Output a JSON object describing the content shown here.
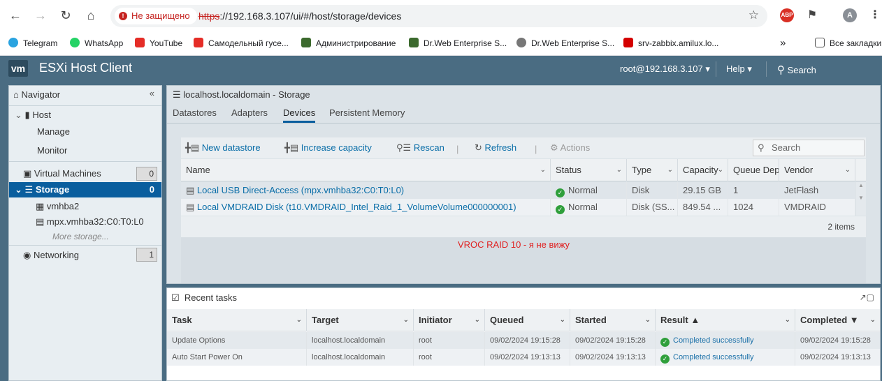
{
  "browser": {
    "insecure_label": "Не защищено",
    "url_scheme": "https",
    "url_rest": "://192.168.3.107/ui/#/host/storage/devices",
    "avatar_letter": "A",
    "abp_label": "ABP",
    "bookmarks": [
      "Telegram",
      "WhatsApp",
      "YouTube",
      "Самодельный гусе...",
      "Администрирование",
      "Dr.Web Enterprise S...",
      "Dr.Web Enterprise S...",
      "srv-zabbix.amilux.lo..."
    ],
    "more_bookmarks": "»",
    "all_bookmarks": "Все закладки"
  },
  "header": {
    "logo": "vm",
    "title": "ESXi Host Client",
    "user": "root@192.168.3.107",
    "help": "Help",
    "search": "Search"
  },
  "navigator": {
    "title": "Navigator",
    "host": "Host",
    "manage": "Manage",
    "monitor": "Monitor",
    "vms": "Virtual Machines",
    "vms_count": "0",
    "storage": "Storage",
    "storage_count": "0",
    "vmhba2": "vmhba2",
    "mpx": "mpx.vmhba32:C0:T0:L0",
    "more_storage": "More storage...",
    "networking": "Networking",
    "networking_count": "1"
  },
  "main": {
    "title": "localhost.localdomain - Storage",
    "tabs": [
      "Datastores",
      "Adapters",
      "Devices",
      "Persistent Memory"
    ],
    "toolbar": {
      "new_datastore": "New datastore",
      "increase_capacity": "Increase capacity",
      "rescan": "Rescan",
      "refresh": "Refresh",
      "actions": "Actions",
      "search_placeholder": "Search"
    },
    "columns": [
      "Name",
      "Status",
      "Type",
      "Capacity",
      "Queue Dep",
      "Vendor"
    ],
    "rows": [
      {
        "name": "Local USB Direct-Access (mpx.vmhba32:C0:T0:L0)",
        "status": "Normal",
        "type": "Disk",
        "capacity": "29.15 GB",
        "queue": "1",
        "vendor": "JetFlash"
      },
      {
        "name": "Local VMDRAID Disk (t10.VMDRAID_Intel_Raid_1_VolumeVolume000000001)",
        "status": "Normal",
        "type": "Disk (SS...",
        "capacity": "849.54 ...",
        "queue": "1024",
        "vendor": "VMDRAID"
      }
    ],
    "items_count": "2 items",
    "annotation": "VROC RAID 10 - я не вижу",
    "annotation_color": "#e02020"
  },
  "recent": {
    "title": "Recent tasks",
    "columns": [
      "Task",
      "Target",
      "Initiator",
      "Queued",
      "Started",
      "Result ▲",
      "Completed ▼"
    ],
    "rows": [
      {
        "task": "Update Options",
        "target": "localhost.localdomain",
        "initiator": "root",
        "queued": "09/02/2024 19:15:28",
        "started": "09/02/2024 19:15:28",
        "result": "Completed successfully",
        "completed": "09/02/2024 19:15:28"
      },
      {
        "task": "Auto Start Power On",
        "target": "localhost.localdomain",
        "initiator": "root",
        "queued": "09/02/2024 19:13:13",
        "started": "09/02/2024 19:13:13",
        "result": "Completed successfully",
        "completed": "09/02/2024 19:13:13"
      }
    ]
  }
}
